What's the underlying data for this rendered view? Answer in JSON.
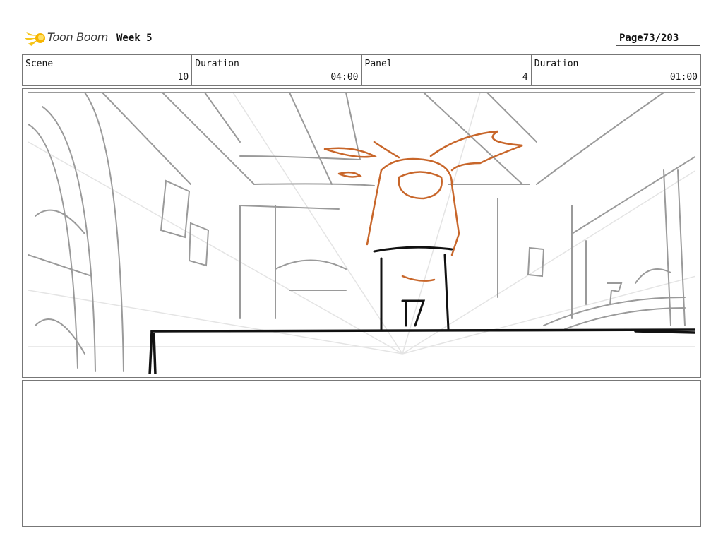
{
  "header": {
    "brand": "Toon Boom",
    "title": "Week 5",
    "page_label": "Page",
    "page_value": "73/203"
  },
  "fields": [
    {
      "label": "Scene",
      "value": "10"
    },
    {
      "label": "Duration",
      "value": "04:00"
    },
    {
      "label": "Panel",
      "value": "4"
    },
    {
      "label": "Duration",
      "value": "01:00"
    }
  ],
  "colors": {
    "sketch_gray": "#9a9a9a",
    "ink_black": "#111111",
    "character_orange": "#c8662a",
    "logo_yellow": "#f5c518"
  }
}
